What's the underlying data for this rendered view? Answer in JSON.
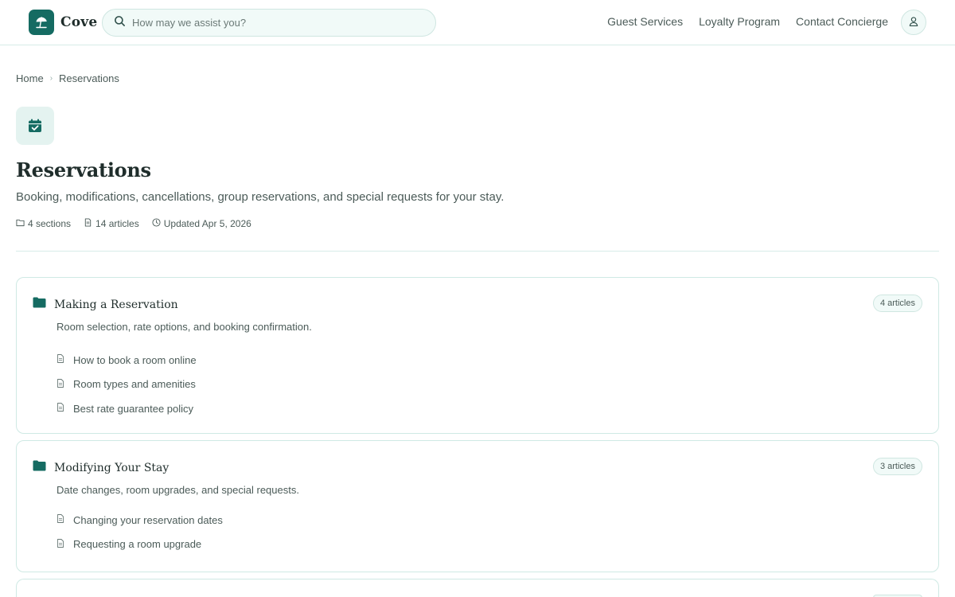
{
  "header": {
    "brand": "Cove",
    "search_placeholder": "How may we assist you?",
    "nav": [
      "Guest Services",
      "Loyalty Program",
      "Contact Concierge"
    ]
  },
  "breadcrumb": [
    "Home",
    "Reservations"
  ],
  "page": {
    "title": "Reservations",
    "description": "Booking, modifications, cancellations, group reservations, and special requests for your stay.",
    "meta": {
      "sections": "4 sections",
      "articles": "14 articles",
      "updated": "Updated Apr 5, 2026"
    }
  },
  "sections": [
    {
      "title": "Making a Reservation",
      "count": "4 articles",
      "description": "Room selection, rate options, and booking confirmation.",
      "articles": [
        "How to book a room online",
        "Room types and amenities",
        "Best rate guarantee policy"
      ]
    },
    {
      "title": "Modifying Your Stay",
      "count": "3 articles",
      "description": "Date changes, room upgrades, and special requests.",
      "articles": [
        "Changing your reservation dates",
        "Requesting a room upgrade"
      ]
    }
  ],
  "colors": {
    "brand": "#156b62",
    "border": "#cfe9e4",
    "muted_text": "#4b5b58",
    "tint": "#f1faf8"
  }
}
